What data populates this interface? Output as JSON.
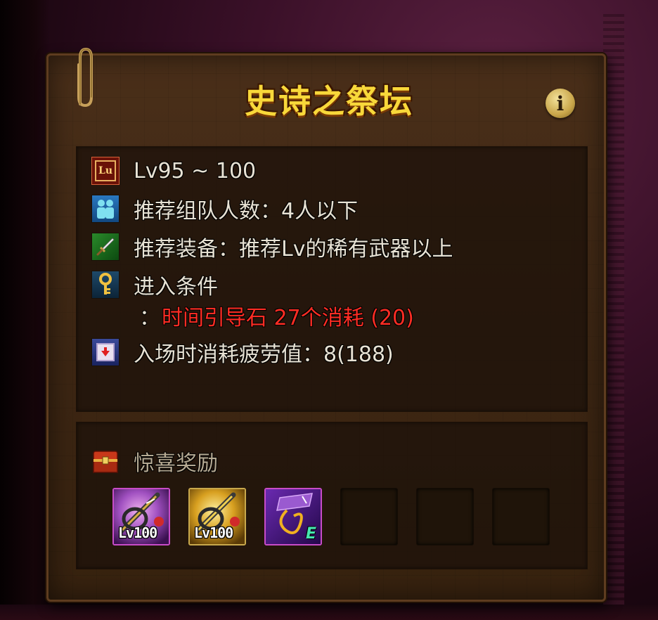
{
  "dungeon": {
    "title": "史诗之祭坛"
  },
  "info": {
    "level": "Lv95 ~ 100",
    "party": "推荐组队人数：4人以下",
    "equipment": "推荐装备：推荐Lv的稀有武器以上",
    "entry_condition_label": "进入条件",
    "entry_condition_colon": "：",
    "entry_condition_value": "时间引导石 27个消耗 (20)",
    "fatigue": "入场时消耗疲劳值：8(188)"
  },
  "rewards": {
    "title": "惊喜奖励",
    "items": [
      {
        "icon": "epic-weapon-icon",
        "level_tag": "Lv100",
        "rarity": "epic"
      },
      {
        "icon": "legendary-weapon-icon",
        "level_tag": "Lv100",
        "rarity": "legendary"
      },
      {
        "icon": "epic-material-icon",
        "tag": "E",
        "rarity": "epic"
      }
    ],
    "empty_slots": 3
  },
  "colors": {
    "title": "#f8d83a",
    "condition_red": "#ff2d24",
    "board": "#3e2714"
  }
}
